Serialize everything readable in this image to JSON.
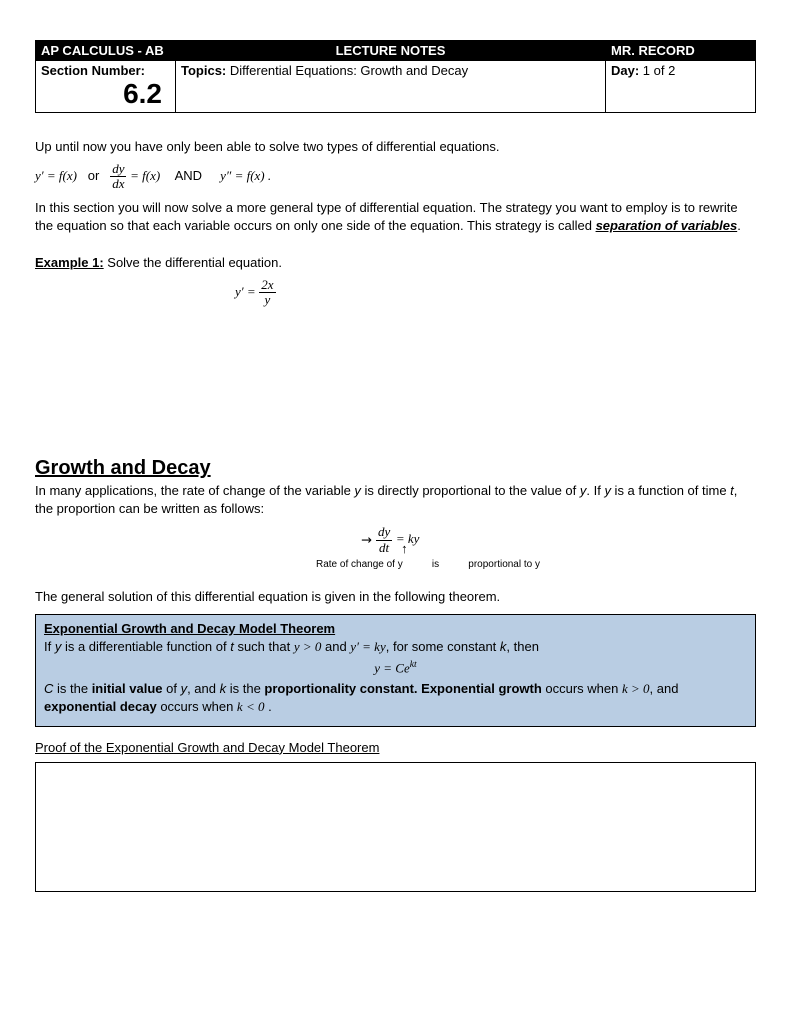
{
  "header": {
    "course": "AP CALCULUS - AB",
    "lecture": "LECTURE NOTES",
    "teacher": "MR. RECORD",
    "section_label": "Section Number:",
    "section_number": "6.2",
    "topics_label": "Topics:",
    "topics_value": "  Differential Equations:  Growth and Decay",
    "day_label": "Day:",
    "day_value": "  1  of  2"
  },
  "intro": {
    "p1": "Up until now you have only been able to solve two types of differential equations.",
    "eq1_a": "y′ = f(x)",
    "eq1_or": "or",
    "eq1_and": "AND",
    "eq1_c": "y″ = f(x) .",
    "p2": "In this section you will now solve a more general type of differential equation.  The strategy you want to employ is to rewrite the equation so that each variable occurs on only one side of the equation.  This strategy is called ",
    "sep": "separation of variables",
    "period": "."
  },
  "example1": {
    "label": "Example 1:",
    "text": "  Solve the differential equation.",
    "eq_lhs": "y′ =",
    "num": "2x",
    "den": "y"
  },
  "growth": {
    "title": "Growth and Decay",
    "p1a": "In many applications, the rate of change of the variable ",
    "y": "y",
    "p1b": " is directly proportional to the value of ",
    "p1c": ".  If ",
    "p1d": " is a function of time ",
    "t": "t",
    "p1e": ", the proportion can be written as follows:",
    "eq_num": "dy",
    "eq_den": "dt",
    "eq_rhs": "= ky",
    "annot_left": "Rate of change of y",
    "annot_mid": "is",
    "annot_right": "proportional to y",
    "p2": "The general solution of this differential equation is given in the following theorem."
  },
  "theorem": {
    "title": "Exponential Growth and Decay Model Theorem",
    "line1a": "If ",
    "line1b": " is a differentiable function of ",
    "line1c": " such that  ",
    "cond1": "y > 0",
    "and": "  and  ",
    "cond2": "y′ = ky",
    "line1d": ",  for some constant ",
    "k": "k",
    "line1e": ", then",
    "eq": "y = Ce",
    "eq_exp": "kt",
    "line2a": "C",
    "line2b": " is the ",
    "init": "initial value",
    "line2c": " of ",
    "line2d": ", and ",
    "line2e": " is the ",
    "prop": "proportionality constant.",
    "line2f": "   ",
    "expg": "Exponential growth",
    "line2g": " occurs when  ",
    "kgt0": "k > 0",
    "line2h": ", and ",
    "expd": "exponential decay",
    "line2i": " occurs when  ",
    "klt0": "k < 0",
    "line2j": " ."
  },
  "proof": {
    "title": "Proof of the Exponential Growth and Decay Model Theorem"
  }
}
